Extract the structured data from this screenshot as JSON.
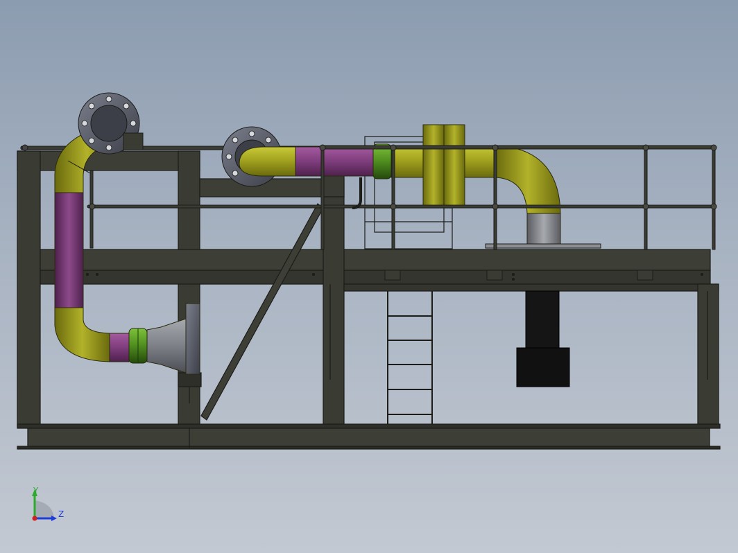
{
  "viewport": {
    "background_top": "#8c9cb0",
    "background_bottom": "#c3c9d2"
  },
  "model": {
    "frame_color": "#3d3e36",
    "frame_edge": "#1c1c18",
    "pipe_yellow": "#9a9a1a",
    "pipe_purple": "#7e3d7c",
    "pipe_green": "#4f8c1f",
    "pipe_grey": "#8f9298",
    "flange_color": "#5a5d68",
    "pump_block": "#111111"
  },
  "triad": {
    "y_label": "Y",
    "z_label": "Z",
    "y_color": "#2eaa2e",
    "z_color": "#1e3cd8",
    "origin_color": "#d22020"
  }
}
